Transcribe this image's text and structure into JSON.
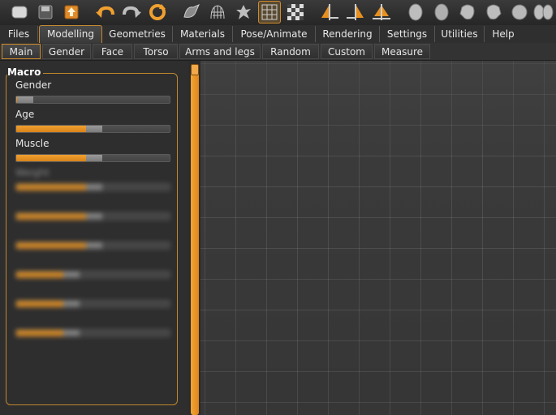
{
  "colors": {
    "accent": "#e8901f",
    "panel_bg": "#2e2e2e",
    "viewport_bg": "#3a3a3a"
  },
  "toolbar": {
    "tools": [
      "new-file-icon",
      "save-icon",
      "export-icon",
      "undo-icon",
      "redo-icon",
      "reset-icon",
      "smooth-icon",
      "wireframe-icon",
      "pose-icon",
      "grid-icon",
      "checker-icon",
      "symmetry-right-icon",
      "symmetry-left-icon",
      "symmetry-icon",
      "front-view-icon",
      "back-view-icon",
      "left-view-icon",
      "right-view-icon",
      "top-view-icon",
      "bottom-view-icon"
    ]
  },
  "menu": {
    "tabs": [
      "Files",
      "Modelling",
      "Geometries",
      "Materials",
      "Pose/Animate",
      "Rendering",
      "Settings",
      "Utilities",
      "Help"
    ],
    "selected": "Modelling"
  },
  "subtabs": {
    "tabs": [
      "Main",
      "Gender",
      "Face",
      "Torso",
      "Arms and legs",
      "Random",
      "Custom",
      "Measure"
    ],
    "selected": "Main"
  },
  "macro": {
    "title": "Macro",
    "sliders": [
      {
        "label": "Gender",
        "value": 0.0
      },
      {
        "label": "Age",
        "value": 0.5
      },
      {
        "label": "Muscle",
        "value": 0.5
      },
      {
        "label": "Weight",
        "value": 0.5
      }
    ]
  }
}
